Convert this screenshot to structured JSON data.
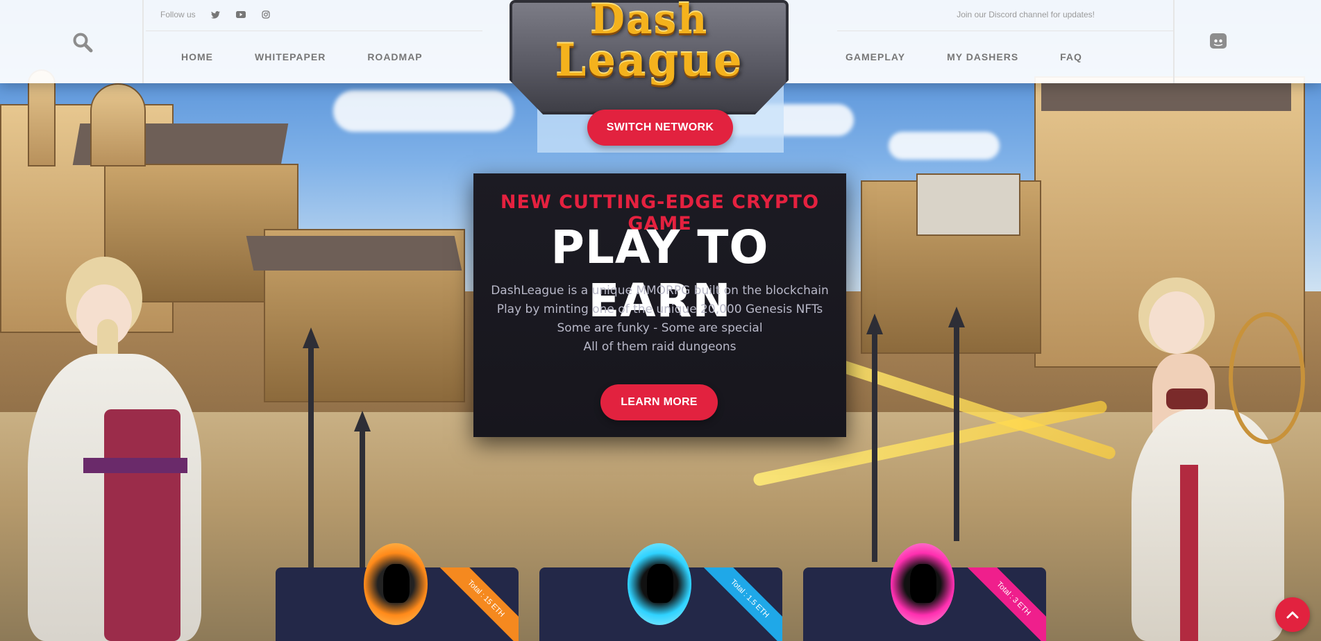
{
  "header": {
    "follow_label": "Follow us",
    "social_icons": [
      "twitter-icon",
      "youtube-icon",
      "instagram-icon"
    ],
    "discord_text": "Join our Discord channel for updates!",
    "nav_left": [
      {
        "label": "HOME"
      },
      {
        "label": "WHITEPAPER"
      },
      {
        "label": "ROADMAP"
      }
    ],
    "nav_right": [
      {
        "label": "GAMEPLAY"
      },
      {
        "label": "MY DASHERS"
      },
      {
        "label": "FAQ"
      }
    ]
  },
  "logo": {
    "line1": "Dash",
    "line2": "League"
  },
  "switch_network": {
    "label": "SWITCH NETWORK"
  },
  "hero": {
    "tagline": "NEW CUTTING-EDGE CRYPTO GAME",
    "title": "PLAY TO EARN",
    "lines": [
      "DashLeague is a unique MMORPG built on the blockchain",
      "Play by minting one of the unique 20,000 Genesis NFTs",
      "Some are funky - Some are special",
      "All of them raid dungeons"
    ],
    "cta": "LEARN MORE"
  },
  "cards": [
    {
      "total": "Total : 15 ETH",
      "accent": "#f5891f",
      "orb": "#ff8a1a"
    },
    {
      "total": "Total : 1.5 ETH",
      "accent": "#1fa8e8",
      "orb": "#2fd2ff"
    },
    {
      "total": "Total : 3 ETH",
      "accent": "#ef1f8c",
      "orb": "#ff2fb0"
    }
  ],
  "colors": {
    "accent_red": "#e2223f",
    "card_bg": "#232848",
    "hero_bg": "#1c1b23"
  }
}
